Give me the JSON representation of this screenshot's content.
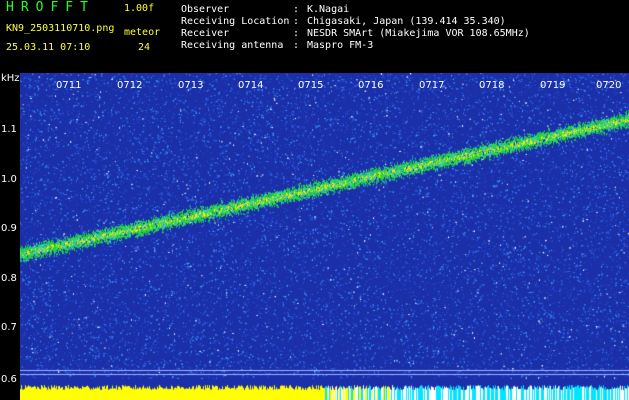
{
  "header": {
    "app_title": "HROFFT",
    "version": "1.00f",
    "filename": "KN9_2503110710.png",
    "mode": "meteor",
    "datetime": "25.03.11 07:10",
    "count": "24"
  },
  "info": [
    {
      "label": "Observer",
      "value": "K.Nagai"
    },
    {
      "label": "Receiving Location",
      "value": "Chigasaki, Japan (139.414 35.340)"
    },
    {
      "label": "Receiver",
      "value": "NESDR SMArt (Miakejima VOR 108.65MHz)"
    },
    {
      "label": "Receiving antenna",
      "value": "Maspro FM-3"
    }
  ],
  "spectrogram": {
    "freq_unit": "kHz",
    "freq_labels": [
      "1.1",
      "1.0",
      "0.9",
      "0.8",
      "0.7",
      "0.6"
    ],
    "time_labels": [
      "0711",
      "0712",
      "0713",
      "0714",
      "0715",
      "0716",
      "0717",
      "0718",
      "0719",
      "0720"
    ],
    "trace_freq_start": 0.85,
    "trace_freq_end": 1.12,
    "colors": {
      "background": "#1a2fa8",
      "noise": "#3a7fff",
      "trace": "#22dd33",
      "trace_hot": "#ffee00",
      "baseline": "#ffff00",
      "baseline_end": "#00e5ff"
    }
  }
}
